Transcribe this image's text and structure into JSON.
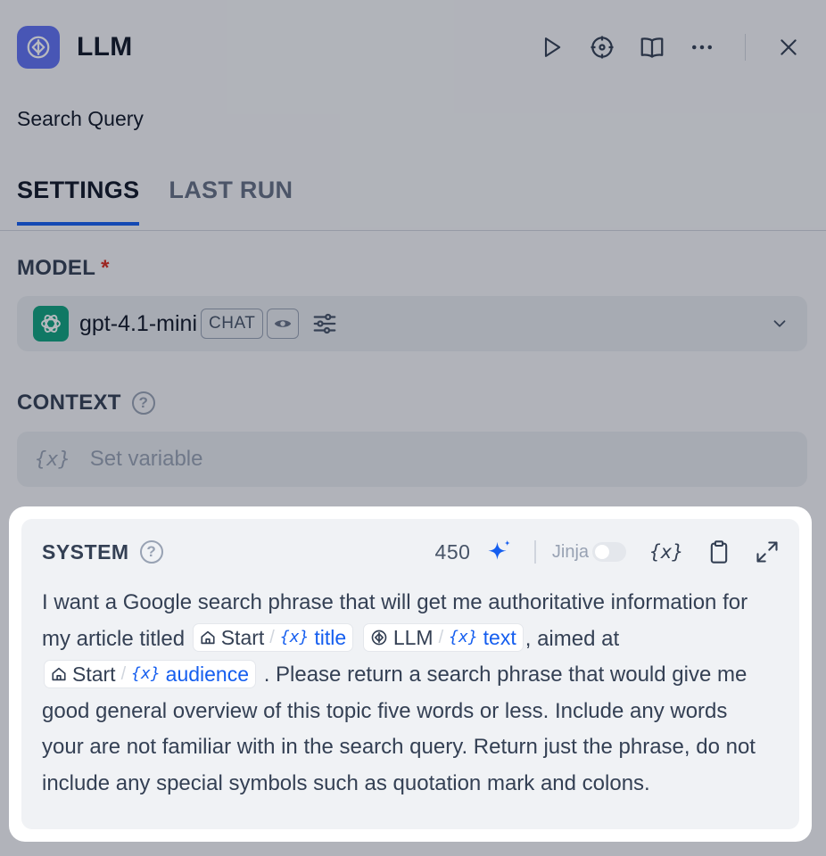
{
  "header": {
    "title": "LLM",
    "description": "Search Query"
  },
  "tabs": [
    {
      "label": "SETTINGS",
      "active": true
    },
    {
      "label": "LAST RUN",
      "active": false
    }
  ],
  "model": {
    "label": "MODEL",
    "required_mark": "*",
    "name": "gpt-4.1-mini",
    "mode_badge": "CHAT"
  },
  "context": {
    "label": "CONTEXT",
    "placeholder": "Set variable",
    "var_icon": "{x}"
  },
  "system": {
    "label": "SYSTEM",
    "char_count": "450",
    "jinja_label": "Jinja",
    "jinja_enabled": false,
    "var_button": "{x}",
    "text": {
      "part1": "I want a Google search phrase that will get me authoritative information for my article titled",
      "part2": ", aimed at",
      "part3": ". Please return a search phrase that would give me good general overview of this topic five words or less. Include any words your are not familiar with in the search query. Return just the phrase, do not include any special symbols such as quotation mark and colons."
    },
    "variables": [
      {
        "node": "Start",
        "sep": "/",
        "icon": "{x}",
        "var": "title"
      },
      {
        "node": "LLM",
        "sep": "/",
        "icon": "{x}",
        "var": "text"
      },
      {
        "node": "Start",
        "sep": "/",
        "icon": "{x}",
        "var": "audience"
      }
    ]
  },
  "colors": {
    "accent": "#155eef",
    "node_icon_bg": "#6172f3",
    "openai_green": "#10a37f",
    "required": "#d92d20"
  }
}
